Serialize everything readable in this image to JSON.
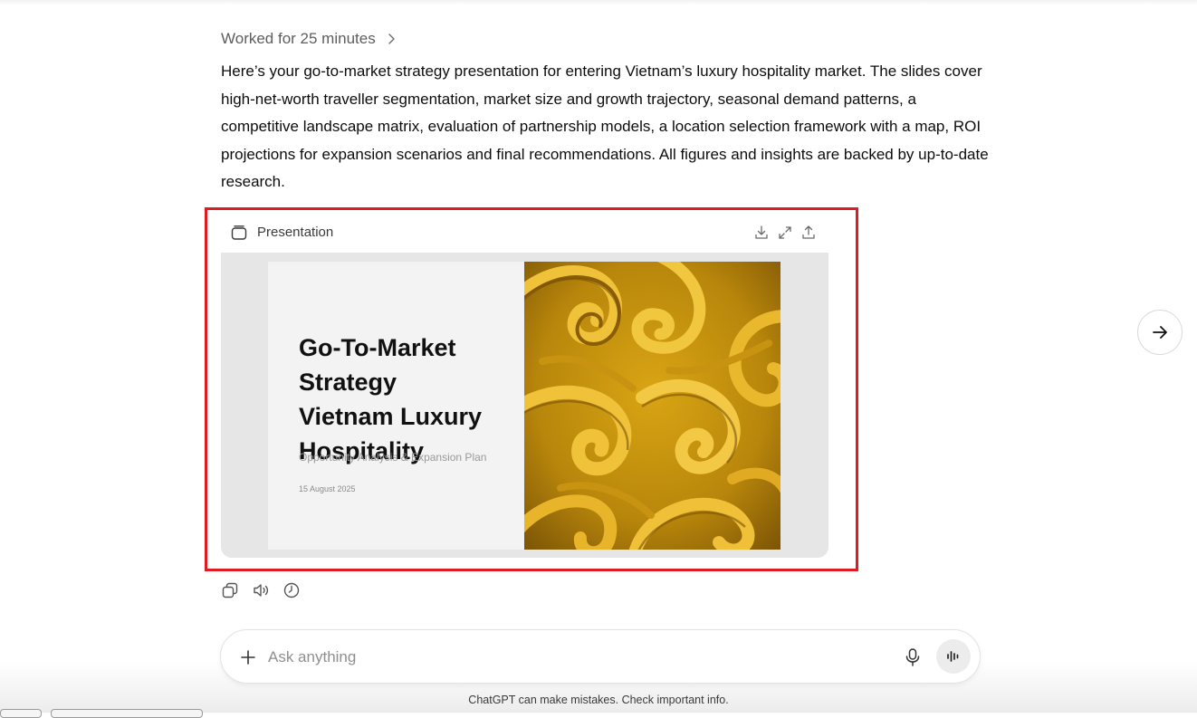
{
  "thinking": {
    "label": "Worked for 25 minutes",
    "icon": "chevron-right-icon"
  },
  "message": {
    "text": "Here’s your go-to-market strategy presentation for entering Vietnam’s luxury hospitality market. The slides cover high-net-worth traveller segmentation, market size and growth trajectory, seasonal demand patterns, a competitive landscape matrix, evaluation of partnership models, a location selection framework with a map, ROI projections for expansion scenarios and final recommendations. All figures and insights are backed by up-to-date research."
  },
  "presentation": {
    "header_label": "Presentation",
    "header_icon": "slides-icon",
    "actions": [
      "download-icon",
      "expand-icon",
      "share-icon"
    ],
    "slide": {
      "title": "Go-To-Market\nStrategy\nVietnam Luxury\nHospitality",
      "subtitle": "Opportunity Analysis & Expansion Plan",
      "date": "15 August 2025",
      "image": "gold-swirl-pattern"
    }
  },
  "navigation": {
    "next_icon": "arrow-right-icon"
  },
  "message_actions": [
    "copy-icon",
    "read-aloud-icon",
    "history-icon"
  ],
  "composer": {
    "placeholder": "Ask anything",
    "icons": [
      "plus-icon",
      "microphone-icon",
      "voice-mode-icon"
    ]
  },
  "footer": {
    "disclaimer": "ChatGPT can make mistakes. Check important info."
  },
  "colors": {
    "highlight_border": "#e01b22",
    "gold": "#c9970f",
    "text": "#0d0d0d",
    "muted": "#5d5d5d"
  }
}
